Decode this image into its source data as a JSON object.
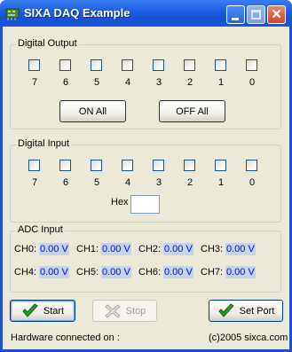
{
  "window": {
    "title": "SIXA DAQ Example",
    "icon": "daq-app-icon",
    "controls": [
      "minimize-icon",
      "maximize-icon",
      "close-icon"
    ]
  },
  "digital_output": {
    "label": "Digital Output",
    "bits": [
      "7",
      "6",
      "5",
      "4",
      "3",
      "2",
      "1",
      "0"
    ],
    "checked": [
      false,
      false,
      false,
      false,
      false,
      false,
      false,
      false
    ],
    "on_all_label": "ON All",
    "off_all_label": "OFF All"
  },
  "digital_input": {
    "label": "Digital Input",
    "bits": [
      "7",
      "6",
      "5",
      "4",
      "3",
      "2",
      "1",
      "0"
    ],
    "checked": [
      false,
      false,
      false,
      false,
      false,
      false,
      false,
      false
    ],
    "hex_label": "Hex",
    "hex_value": ""
  },
  "adc_input": {
    "label": "ADC Input",
    "channels": [
      {
        "name": "CH0:",
        "value": "0.00 V"
      },
      {
        "name": "CH1:",
        "value": "0.00 V"
      },
      {
        "name": "CH2:",
        "value": "0.00 V"
      },
      {
        "name": "CH3:",
        "value": "0.00 V"
      },
      {
        "name": "CH4:",
        "value": "0.00 V"
      },
      {
        "name": "CH5:",
        "value": "0.00 V"
      },
      {
        "name": "CH6:",
        "value": "0.00 V"
      },
      {
        "name": "CH7:",
        "value": "0.00 V"
      }
    ]
  },
  "buttons": {
    "start_label": "Start",
    "start_icon": "green-checkmark-icon",
    "stop_label": "Stop",
    "stop_icon": "gray-x-icon",
    "stop_enabled": false,
    "set_port_label": "Set Port",
    "set_port_icon": "green-checkmark-icon"
  },
  "status": {
    "hardware": "Hardware connected on :",
    "copyright": "(c)2005 sixca.com"
  },
  "colors": {
    "titlebar": "#1e5fe0",
    "client_bg": "#ece9d8",
    "adc_value_text": "#0000ff",
    "adc_value_bg": "#c5d3ec",
    "check_green": "#2e9a2e"
  }
}
